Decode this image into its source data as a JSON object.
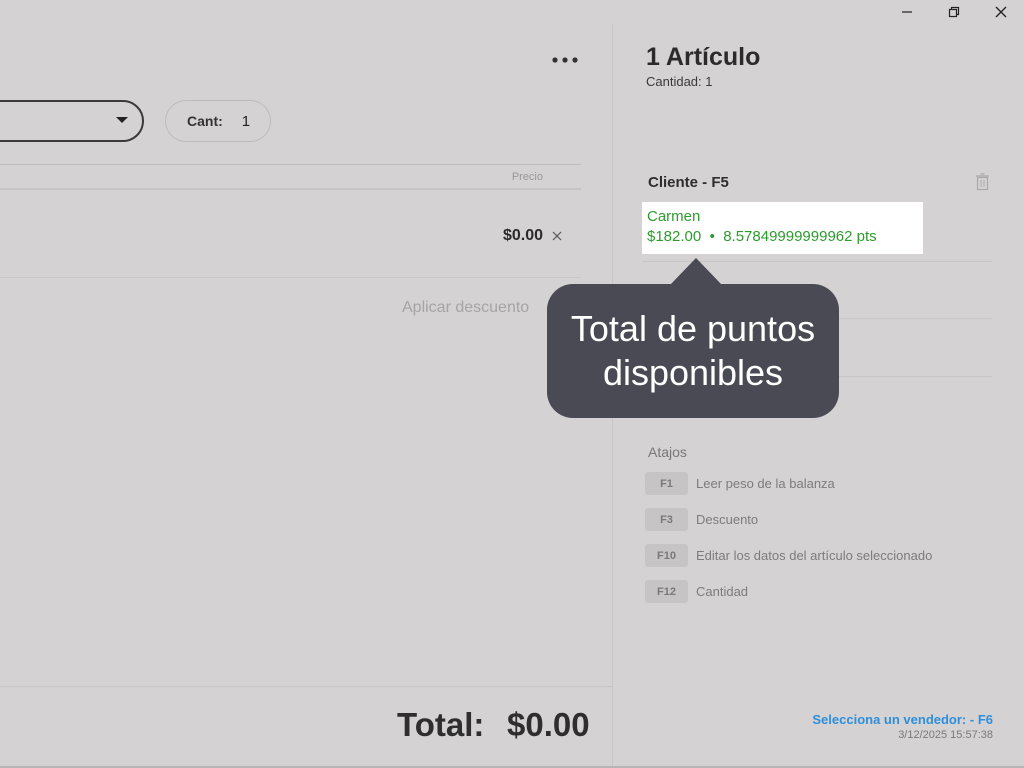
{
  "window": {
    "controls": [
      {
        "name": "minimize-icon"
      },
      {
        "name": "restore-icon"
      },
      {
        "name": "close-icon"
      }
    ]
  },
  "left": {
    "quantity": {
      "label": "Cant:",
      "value": "1"
    },
    "table": {
      "price_header": "Precio"
    },
    "line_item": {
      "price": "$0.00"
    },
    "discount_label": "Aplicar descuento",
    "total": {
      "label": "Total:",
      "value": "$0.00"
    }
  },
  "right": {
    "title": "1 Artículo",
    "subtitle": "Cantidad: 1",
    "client": {
      "header": "Cliente - F5",
      "name": "Carmen",
      "balance": "$182.00",
      "bullet": "•",
      "points": "8.57849999999962 pts"
    },
    "tooltip": "Total de puntos disponibles",
    "shortcuts": {
      "title": "Atajos",
      "items": [
        {
          "key": "F1",
          "desc": "Leer peso de la balanza"
        },
        {
          "key": "F3",
          "desc": "Descuento"
        },
        {
          "key": "F10",
          "desc": "Editar los datos del artículo seleccionado"
        },
        {
          "key": "F12",
          "desc": "Cantidad"
        }
      ]
    },
    "seller": "Selecciona un vendedor: - F6",
    "datetime": "3/12/2025 15:57:38"
  },
  "colors": {
    "background": "#d4d2d3",
    "client_green": "#2e9a2e",
    "tooltip_bg": "#4a4a55",
    "seller_blue": "#2f8fdc"
  }
}
